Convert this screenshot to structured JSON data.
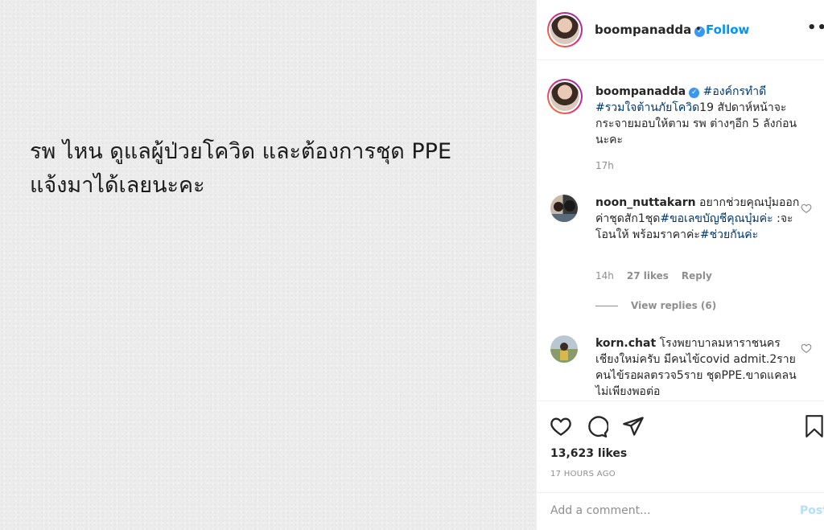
{
  "post_image": {
    "line1": "รพ ไหน ดูแลผู้ป่วยโควิด และต้องการชุด PPE",
    "line2": "แจ้งมาได้เลยนะคะ"
  },
  "header": {
    "username": "boompanadda",
    "dot": "•",
    "follow_label": "Follow",
    "more_label": "•••"
  },
  "caption": {
    "username": "boompanadda",
    "tag1": "#องค์กรทำดี",
    "tag2": "#รวมใจต้านภัยโควิด",
    "tag2_suffix": "19",
    "body": "สัปดาห์หน้าจะกระจายมอบให้ตาม รพ ต่างๆอีก 5 ลังก่อนนะคะ",
    "time": "17h"
  },
  "comments": [
    {
      "username": "noon_nuttakarn",
      "text_a": "อยากช่วยคุณบุ๋มออกค่าชุดสัก1ชุด",
      "tag_a": "#ขอเลขบัญชีคุณบุ๋มค่ะ",
      "text_b": " :จะโอนให้ พร้อมราคาค่ะ",
      "tag_b": "#ช่วยกันค่ะ",
      "time": "14h",
      "likes": "27 likes",
      "reply_label": "Reply",
      "view_replies": "View replies (6)"
    },
    {
      "username": "korn.chat",
      "text": "โรงพยาบาลมหาราชนครเชียงใหม่ครับ มีคนไข้covid admit.2ราย คนไข้รอผลตรวจ5ราย ชุดPPE.ขาดแคลนไม่เพียงพอต่อ"
    }
  ],
  "actions": {
    "likes": "13,623 likes",
    "time": "17 HOURS AGO"
  },
  "add_comment": {
    "placeholder": "Add a comment...",
    "post_label": "Post"
  },
  "colors": {
    "link_blue": "#0095f6",
    "hashtag": "#00376b",
    "muted": "#8e8e8e"
  }
}
